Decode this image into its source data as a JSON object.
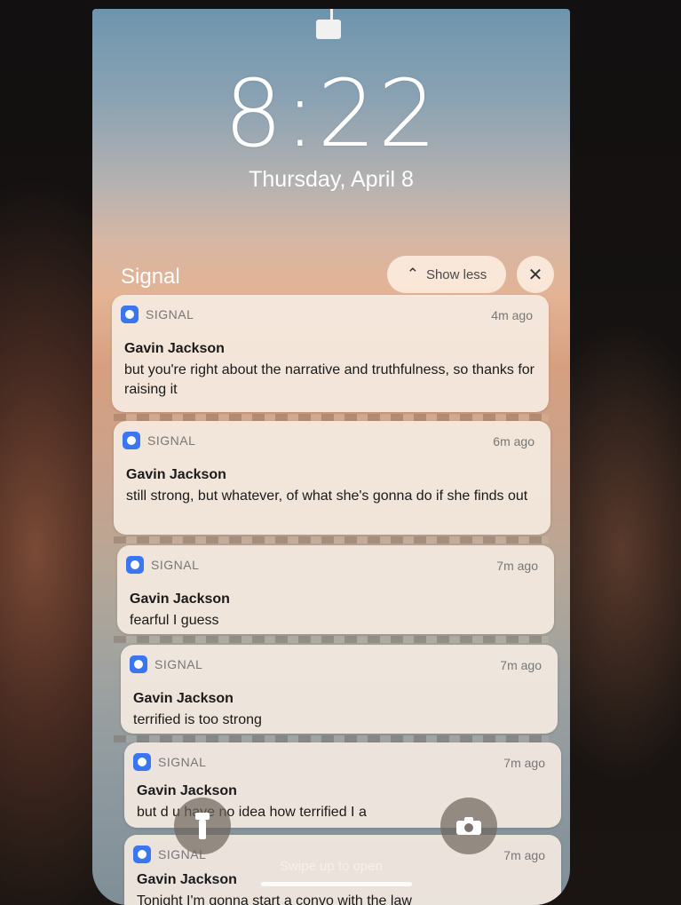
{
  "lock_screen": {
    "time": "8:22",
    "date": "Thursday, April 8"
  },
  "notification_group": {
    "title": "Signal",
    "show_less_label": "Show less",
    "close_label": "✕"
  },
  "notifications": [
    {
      "app": "SIGNAL",
      "time": "4m ago",
      "sender": "Gavin Jackson",
      "message": "but you're right about the narrative and truthfulness, so thanks for raising it"
    },
    {
      "app": "SIGNAL",
      "time": "6m ago",
      "sender": "Gavin Jackson",
      "message": "still strong, but whatever, of what she's gonna do if she finds out"
    },
    {
      "app": "SIGNAL",
      "time": "7m ago",
      "sender": "Gavin Jackson",
      "message": "fearful I guess"
    },
    {
      "app": "SIGNAL",
      "time": "7m ago",
      "sender": "Gavin Jackson",
      "message": "terrified is too strong"
    },
    {
      "app": "SIGNAL",
      "time": "7m ago",
      "sender": "Gavin Jackson",
      "message": "but d u have no idea how terrified I a"
    },
    {
      "app": "SIGNAL",
      "time": "7m ago",
      "sender": "Gavin Jackson",
      "message": "Tonight I'm gonna start a convo with the law"
    }
  ],
  "footer": {
    "swipe_hint": "Swipe up to open"
  },
  "icons": {
    "flashlight": "flashlight-icon",
    "camera": "camera-icon",
    "app": "signal-app-icon"
  },
  "colors": {
    "signal_blue": "#3a76f0"
  }
}
